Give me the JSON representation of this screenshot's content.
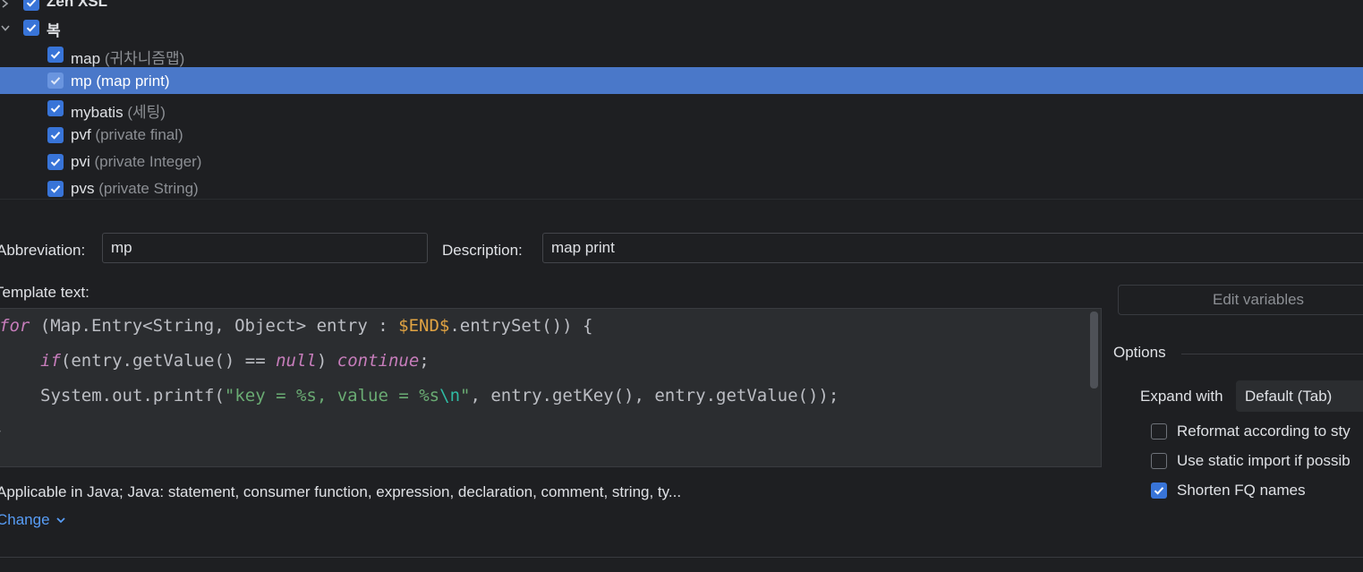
{
  "tree": {
    "groups": [
      {
        "label": "Zen XSL",
        "expanded": false
      },
      {
        "label": "복",
        "expanded": true
      }
    ],
    "items": [
      {
        "name": "map",
        "desc": "(귀차니즘맵)"
      },
      {
        "name": "mp",
        "desc": "(map print)"
      },
      {
        "name": "mybatis",
        "desc": "(세팅)"
      },
      {
        "name": "pvf",
        "desc": "(private final)"
      },
      {
        "name": "pvi",
        "desc": "(private Integer)"
      },
      {
        "name": "pvs",
        "desc": "(private String)"
      }
    ],
    "selected": "mp"
  },
  "form": {
    "abbreviation_label": "Abbreviation:",
    "abbreviation_value": "mp",
    "description_label": "Description:",
    "description_value": "map print",
    "template_text_label": "Template text:"
  },
  "code": {
    "line1_kw": "for",
    "line1_a": " (Map.Entry<String, Object> entry : ",
    "line1_var": "$END$",
    "line1_b": ".entrySet()) {",
    "line2_kw1": "if",
    "line2_a": "(entry.getValue() == ",
    "line2_kw2": "null",
    "line2_b": ") ",
    "line2_kw3": "continue",
    "line2_c": ";",
    "line3_a": "System.out.printf(",
    "line3_str1": "\"key = %s, value = %s",
    "line3_esc": "\\n",
    "line3_str2": "\"",
    "line3_b": ", entry.getKey(), entry.getValue());",
    "line4": "}"
  },
  "options": {
    "edit_variables": "Edit variables",
    "title": "Options",
    "expand_with_label": "Expand with",
    "expand_with_value": "Default (Tab)",
    "reformat_label": "Reformat according to sty",
    "reformat_checked": false,
    "static_import_label": "Use static import if possib",
    "static_import_checked": false,
    "shorten_fq_label": "Shorten FQ names",
    "shorten_fq_checked": true
  },
  "context": {
    "applicable": "Applicable in Java; Java: statement, consumer function, expression, declaration, comment, string, ty...",
    "change": "Change"
  },
  "colors": {
    "background": "#1e1f22",
    "selection": "#4a78c9",
    "checkbox": "#3874d8",
    "link": "#589df6",
    "keyword": "#c77dbb",
    "string": "#6aab73",
    "variable": "#e0a343"
  }
}
